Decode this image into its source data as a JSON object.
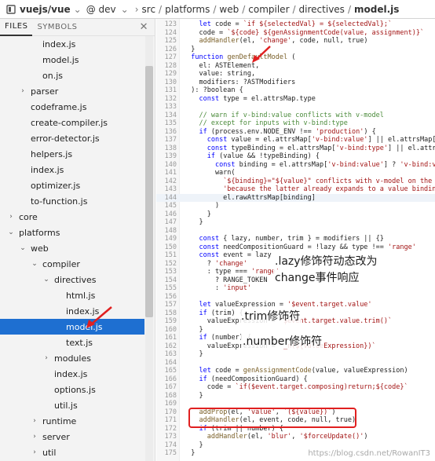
{
  "topbar": {
    "repo": "vuejs/vue",
    "branch": "@ dev",
    "path": [
      "src",
      "platforms",
      "web",
      "compiler",
      "directives"
    ],
    "file": "model.js"
  },
  "sidebar": {
    "tabs": [
      "FILES",
      "SYMBOLS"
    ],
    "close_glyph": "✕",
    "items": [
      {
        "label": "index.js",
        "indent": 2,
        "chevron": ""
      },
      {
        "label": "model.js",
        "indent": 2,
        "chevron": ""
      },
      {
        "label": "on.js",
        "indent": 2,
        "chevron": ""
      },
      {
        "label": "parser",
        "indent": 1,
        "chevron": "›"
      },
      {
        "label": "codeframe.js",
        "indent": 1,
        "chevron": ""
      },
      {
        "label": "create-compiler.js",
        "indent": 1,
        "chevron": ""
      },
      {
        "label": "error-detector.js",
        "indent": 1,
        "chevron": ""
      },
      {
        "label": "helpers.js",
        "indent": 1,
        "chevron": ""
      },
      {
        "label": "index.js",
        "indent": 1,
        "chevron": ""
      },
      {
        "label": "optimizer.js",
        "indent": 1,
        "chevron": ""
      },
      {
        "label": "to-function.js",
        "indent": 1,
        "chevron": ""
      },
      {
        "label": "core",
        "indent": 0,
        "chevron": "›"
      },
      {
        "label": "platforms",
        "indent": 0,
        "chevron": "⌄"
      },
      {
        "label": "web",
        "indent": 1,
        "chevron": "⌄"
      },
      {
        "label": "compiler",
        "indent": 2,
        "chevron": "⌄"
      },
      {
        "label": "directives",
        "indent": 3,
        "chevron": "⌄"
      },
      {
        "label": "html.js",
        "indent": 4,
        "chevron": ""
      },
      {
        "label": "index.js",
        "indent": 4,
        "chevron": ""
      },
      {
        "label": "model.js",
        "indent": 4,
        "chevron": "",
        "selected": true
      },
      {
        "label": "text.js",
        "indent": 4,
        "chevron": ""
      },
      {
        "label": "modules",
        "indent": 3,
        "chevron": "›"
      },
      {
        "label": "index.js",
        "indent": 3,
        "chevron": ""
      },
      {
        "label": "options.js",
        "indent": 3,
        "chevron": ""
      },
      {
        "label": "util.js",
        "indent": 3,
        "chevron": ""
      },
      {
        "label": "runtime",
        "indent": 2,
        "chevron": "›"
      },
      {
        "label": "server",
        "indent": 2,
        "chevron": "›"
      },
      {
        "label": "util",
        "indent": 2,
        "chevron": "›"
      }
    ]
  },
  "editor": {
    "lines": [
      {
        "n": "123",
        "t": "    let code = `if ${selectedVal} = ${selectedVal};`"
      },
      {
        "n": "124",
        "t": "    code = `${code} ${genAssignmentCode(value, assignment)}`"
      },
      {
        "n": "125",
        "t": "    addHandler(el, 'change', code, null, true)"
      },
      {
        "n": "126",
        "t": "  }"
      },
      {
        "n": "127",
        "t": "  function genDefaultModel ("
      },
      {
        "n": "128",
        "t": "    el: ASTElement,"
      },
      {
        "n": "129",
        "t": "    value: string,"
      },
      {
        "n": "130",
        "t": "    modifiers: ?ASTModifiers"
      },
      {
        "n": "131",
        "t": "  ): ?boolean {"
      },
      {
        "n": "132",
        "t": "    const type = el.attrsMap.type"
      },
      {
        "n": "133",
        "t": ""
      },
      {
        "n": "134",
        "t": "    // warn if v-bind:value conflicts with v-model"
      },
      {
        "n": "135",
        "t": "    // except for inputs with v-bind:type"
      },
      {
        "n": "136",
        "t": "    if (process.env.NODE_ENV !== 'production') {"
      },
      {
        "n": "137",
        "t": "      const value = el.attrsMap['v-bind:value'] || el.attrsMap[':"
      },
      {
        "n": "138",
        "t": "      const typeBinding = el.attrsMap['v-bind:type'] || el.attrsM"
      },
      {
        "n": "139",
        "t": "      if (value && !typeBinding) {"
      },
      {
        "n": "140",
        "t": "        const binding = el.attrsMap['v-bind:value'] ? 'v-bind:val"
      },
      {
        "n": "141",
        "t": "        warn("
      },
      {
        "n": "142",
        "t": "          `${binding}=\"${value}\" conflicts with v-model on the sa"
      },
      {
        "n": "143",
        "t": "          'because the latter already expands to a value binding"
      },
      {
        "n": "144",
        "t": "          el.rawAttrsMap[binding]",
        "hl": true
      },
      {
        "n": "145",
        "t": "        )"
      },
      {
        "n": "146",
        "t": "      }"
      },
      {
        "n": "147",
        "t": "    }"
      },
      {
        "n": "148",
        "t": ""
      },
      {
        "n": "149",
        "t": "    const { lazy, number, trim } = modifiers || {}"
      },
      {
        "n": "150",
        "t": "    const needCompositionGuard = !lazy && type !== 'range'"
      },
      {
        "n": "151",
        "t": "    const event = lazy"
      },
      {
        "n": "152",
        "t": "      ? 'change'"
      },
      {
        "n": "153",
        "t": "      : type === 'range'"
      },
      {
        "n": "154",
        "t": "        ? RANGE_TOKEN"
      },
      {
        "n": "155",
        "t": "        : 'input'"
      },
      {
        "n": "156",
        "t": ""
      },
      {
        "n": "157",
        "t": "    let valueExpression = '$event.target.value'"
      },
      {
        "n": "158",
        "t": "    if (trim) {"
      },
      {
        "n": "159",
        "t": "      valueExpression = `$event.target.value.trim()`"
      },
      {
        "n": "160",
        "t": "    }"
      },
      {
        "n": "161",
        "t": "    if (number) {"
      },
      {
        "n": "162",
        "t": "      valueExpression = `_n(${valueExpression})`"
      },
      {
        "n": "163",
        "t": "    }"
      },
      {
        "n": "164",
        "t": ""
      },
      {
        "n": "165",
        "t": "    let code = genAssignmentCode(value, valueExpression)"
      },
      {
        "n": "166",
        "t": "    if (needCompositionGuard) {"
      },
      {
        "n": "167",
        "t": "      code = `if($event.target.composing)return;${code}`"
      },
      {
        "n": "168",
        "t": "    }"
      },
      {
        "n": "169",
        "t": ""
      },
      {
        "n": "170",
        "t": "    addProp(el, 'value', `(${value})`)"
      },
      {
        "n": "171",
        "t": "    addHandler(el, event, code, null, true)"
      },
      {
        "n": "172",
        "t": "    if (trim || number) {"
      },
      {
        "n": "173",
        "t": "      addHandler(el, 'blur', '$forceUpdate()')"
      },
      {
        "n": "174",
        "t": "    }"
      },
      {
        "n": "175",
        "t": "  }"
      }
    ],
    "annotations": {
      "lazy_line1": ".lazy修饰符动态改为",
      "lazy_line2": "change事件响应",
      "trim": ".trim修饰符",
      "number": ".number修饰符"
    },
    "watermark": "https://blog.csdn.net/RowanIT3"
  },
  "colors": {
    "selected": "#1e6fd1",
    "annotation_red": "#e02020"
  }
}
